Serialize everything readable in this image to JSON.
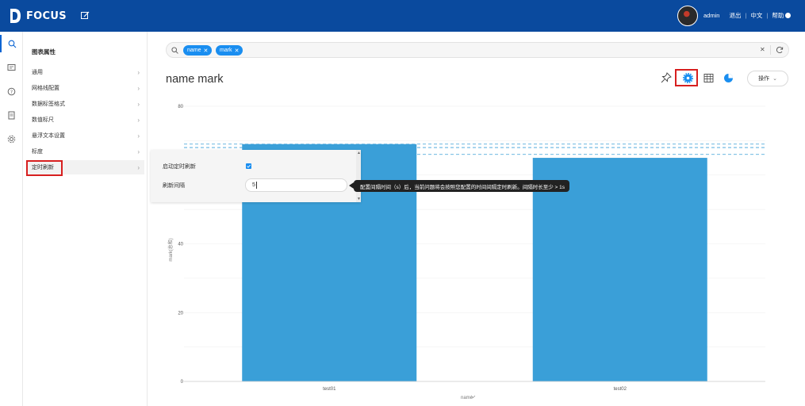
{
  "app": {
    "logo_text": "FOCUS"
  },
  "user": {
    "name": "admin",
    "logout": "退出",
    "lang": "中文",
    "help": "帮助"
  },
  "panel": {
    "title": "图表属性",
    "items": [
      "通用",
      "网格线配置",
      "数据标签格式",
      "数值标尺",
      "悬浮文本设置",
      "标度",
      "定时刷新"
    ]
  },
  "search": {
    "tags": [
      "name",
      "mark"
    ]
  },
  "chart_title": "name mark",
  "toolbar": {
    "op_label": "操作"
  },
  "popup": {
    "enable_label": "启动定时刷新",
    "interval_label": "刷新间隔",
    "interval_value": "5",
    "enabled": true
  },
  "tooltip_text": "配置间隔时间（s）后，当前问题将会按照您配置的时间间隔定时刷新。间隔时长至少 > 1s",
  "colors": {
    "topbar": "#0a4a9e",
    "accent": "#1a8ef0",
    "bar": "#3a9fd8",
    "highlight": "#d71f1f"
  },
  "chart_data": {
    "type": "bar",
    "categories": [
      "test01",
      "test02"
    ],
    "values": [
      69,
      65
    ],
    "xlabel": "name",
    "ylabel": "mark(总和)",
    "ylim": [
      0,
      80
    ],
    "yticks": [
      0,
      20,
      40,
      80
    ],
    "reference_lines": [
      69,
      68,
      66
    ],
    "grid": true
  }
}
